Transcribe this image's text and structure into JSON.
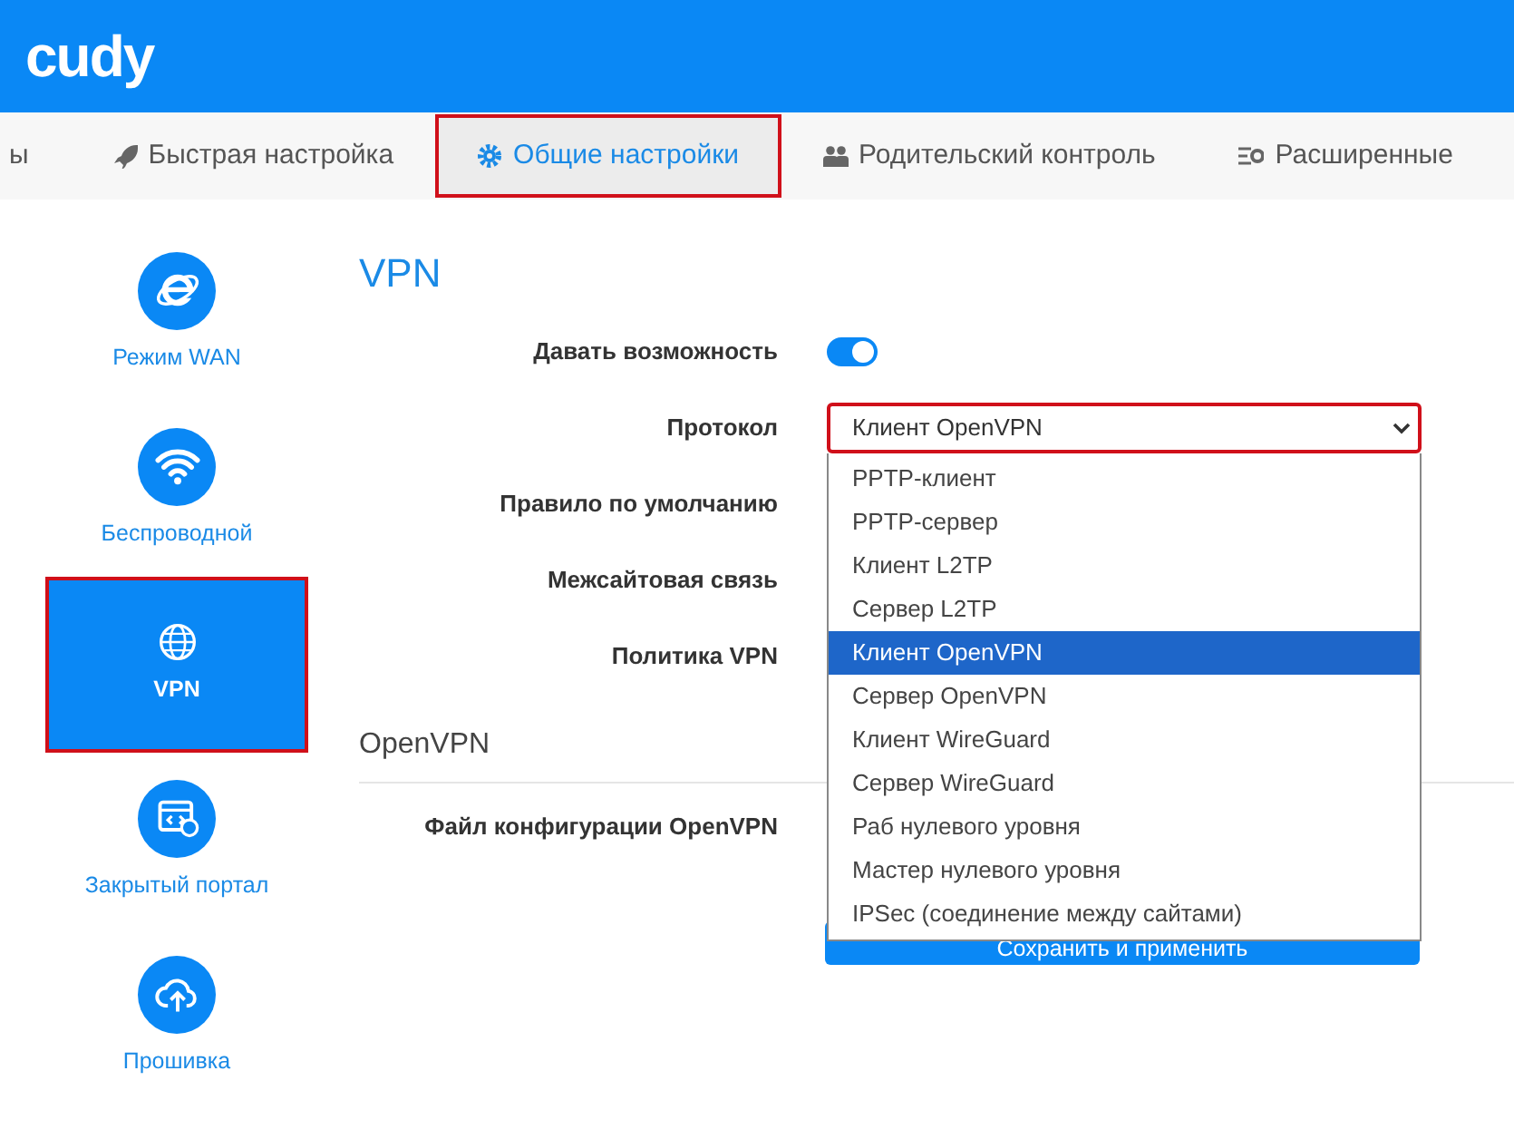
{
  "header": {
    "logo": "cudy"
  },
  "tabs": [
    {
      "label": "ы",
      "selected": false,
      "highlighted": false
    },
    {
      "label": "Быстрая настройка",
      "selected": false,
      "highlighted": false
    },
    {
      "label": "Общие настройки",
      "selected": true,
      "highlighted": true
    },
    {
      "label": "Родительский контроль",
      "selected": false,
      "highlighted": false
    },
    {
      "label": "Расширенные",
      "selected": false,
      "highlighted": false
    }
  ],
  "sidebar": {
    "items": [
      {
        "label": "Режим WAN",
        "selected": false,
        "highlighted": false
      },
      {
        "label": "Беспроводной",
        "selected": false,
        "highlighted": false
      },
      {
        "label": "VPN",
        "selected": true,
        "highlighted": true
      },
      {
        "label": "Закрытый портал",
        "selected": false,
        "highlighted": false
      },
      {
        "label": "Прошивка",
        "selected": false,
        "highlighted": false
      }
    ]
  },
  "title": "VPN",
  "form": [
    {
      "label": "Давать возможность",
      "kind": "switch",
      "on": true
    },
    {
      "label": "Протокол",
      "kind": "select",
      "value": "Клиент OpenVPN",
      "highlighted": true
    },
    {
      "label": "Правило по умолчанию",
      "kind": "blank"
    },
    {
      "label": "Межсайтовая связь",
      "kind": "blank"
    },
    {
      "label": "Политика VPN",
      "kind": "blank"
    }
  ],
  "section": {
    "title": "OpenVPN",
    "fields": [
      {
        "label": "Файл конфигурации OpenVPN"
      }
    ]
  },
  "save_button": "Сохранить и применить",
  "dropdown": {
    "options": [
      {
        "label": "PPTP-клиент",
        "selected": false
      },
      {
        "label": "PPTP-сервер",
        "selected": false
      },
      {
        "label": "Клиент L2TP",
        "selected": false
      },
      {
        "label": "Сервер L2TP",
        "selected": false
      },
      {
        "label": "Клиент OpenVPN",
        "selected": true
      },
      {
        "label": "Сервер OpenVPN",
        "selected": false
      },
      {
        "label": "Клиент WireGuard",
        "selected": false
      },
      {
        "label": "Сервер WireGuard",
        "selected": false
      },
      {
        "label": "Раб нулевого уровня",
        "selected": false
      },
      {
        "label": "Мастер нулевого уровня",
        "selected": false
      },
      {
        "label": "IPSec (соединение между сайтами)",
        "selected": false
      }
    ]
  }
}
